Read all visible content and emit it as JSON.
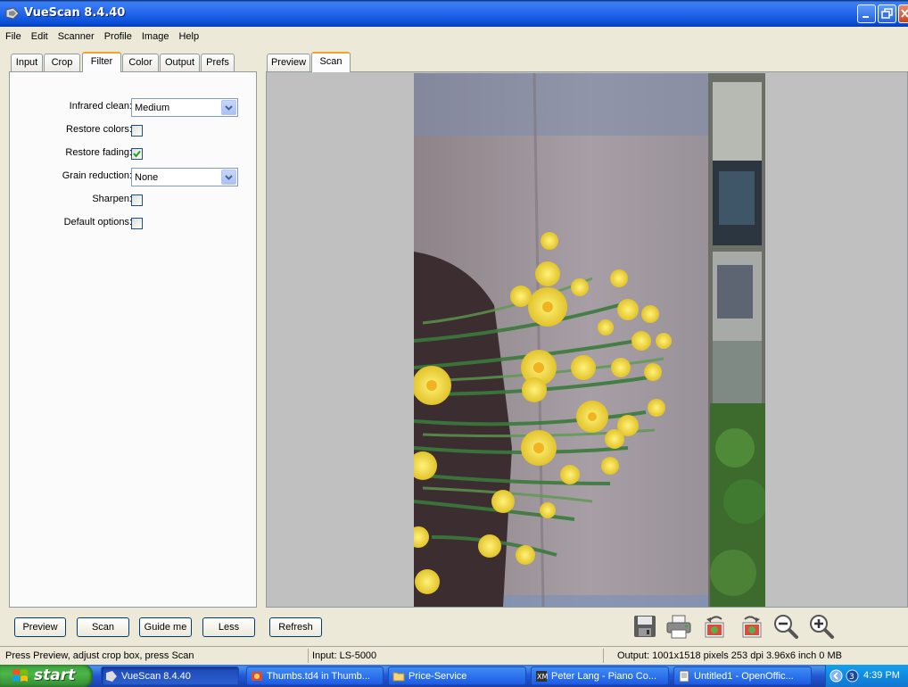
{
  "window": {
    "title": "VueScan 8.4.40"
  },
  "menu": [
    "File",
    "Edit",
    "Scanner",
    "Profile",
    "Image",
    "Help"
  ],
  "left_tabs": [
    {
      "label": "Input",
      "active": false
    },
    {
      "label": "Crop",
      "active": false
    },
    {
      "label": "Filter",
      "active": true
    },
    {
      "label": "Color",
      "active": false
    },
    {
      "label": "Output",
      "active": false
    },
    {
      "label": "Prefs",
      "active": false
    }
  ],
  "filter": {
    "infrared_clean": {
      "label": "Infrared clean:",
      "value": "Medium"
    },
    "restore_colors": {
      "label": "Restore colors:",
      "checked": false
    },
    "restore_fading": {
      "label": "Restore fading:",
      "checked": true
    },
    "grain_reduction": {
      "label": "Grain reduction:",
      "value": "None"
    },
    "sharpen": {
      "label": "Sharpen:",
      "checked": false
    },
    "default_options": {
      "label": "Default options:",
      "checked": false
    }
  },
  "right_tabs": [
    {
      "label": "Preview",
      "active": false
    },
    {
      "label": "Scan",
      "active": true
    }
  ],
  "buttons": {
    "preview": "Preview",
    "scan": "Scan",
    "guide_me": "Guide me",
    "less": "Less",
    "refresh": "Refresh"
  },
  "toolbar_icons": [
    "save-icon",
    "print-icon",
    "rotate-left-icon",
    "rotate-right-icon",
    "zoom-out-icon",
    "zoom-in-icon"
  ],
  "status": {
    "hint": "Press Preview, adjust crop box, press Scan",
    "input": "Input: LS-5000",
    "output": "Output: 1001x1518 pixels 253 dpi 3.96x6 inch 0 MB"
  },
  "taskbar": {
    "start": "start",
    "tasks": [
      {
        "label": "VueScan 8.4.40",
        "icon": "vuescan-icon",
        "active": true
      },
      {
        "label": "Thumbs.td4 in Thumb...",
        "icon": "thumbs-icon",
        "active": false
      },
      {
        "label": "Price-Service",
        "icon": "folder-icon",
        "active": false
      },
      {
        "label": "Peter Lang - Piano Co...",
        "icon": "xm-icon",
        "active": false
      },
      {
        "label": "Untitled1 - OpenOffic...",
        "icon": "openoffice-icon",
        "active": false
      }
    ],
    "clock": "4:39 PM"
  },
  "colors": {
    "titlebar": "#0a57e0",
    "tab_highlight": "#f5a226",
    "preview_bg": "#c0c0c0",
    "taskbar": "#245edb",
    "start_green": "#3c9f3c"
  }
}
